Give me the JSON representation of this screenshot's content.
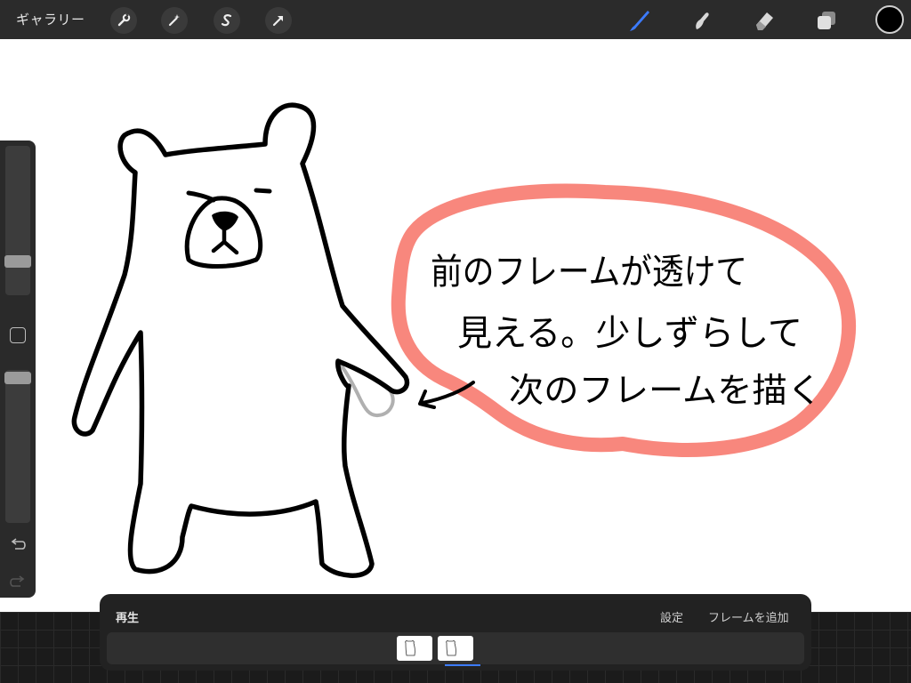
{
  "toolbar": {
    "gallery_label": "ギャラリー",
    "left_tools": [
      {
        "icon": "wrench-icon"
      },
      {
        "icon": "magic-wand-icon"
      },
      {
        "icon": "selection-icon"
      },
      {
        "icon": "transform-arrow-icon"
      }
    ],
    "right_tools": [
      {
        "icon": "brush-icon",
        "active": true
      },
      {
        "icon": "smudge-icon",
        "active": false
      },
      {
        "icon": "eraser-icon",
        "active": false
      },
      {
        "icon": "layers-icon",
        "active": false
      }
    ],
    "current_color": "#000000",
    "active_color": "#3c7bff"
  },
  "canvas": {
    "annotation_lines": [
      "前のフレームが透けて",
      "見える。少しずらして",
      "次のフレームを描く"
    ],
    "bubble_color": "#f8877d"
  },
  "sidebar": {
    "brush_size_level": 0.76,
    "opacity_level": 0.95
  },
  "animation": {
    "play_label": "再生",
    "settings_label": "設定",
    "add_frame_label": "フレームを追加",
    "frames": [
      {
        "selected": false
      },
      {
        "selected": true
      }
    ]
  }
}
